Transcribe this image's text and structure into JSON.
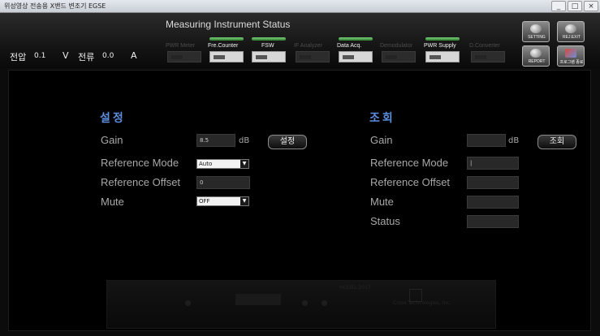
{
  "window": {
    "title": "위성영상 전송용 X밴드 변조기 EGSE",
    "controls": [
      "_",
      "□",
      "×"
    ]
  },
  "header": {
    "title": "Measuring Instrument Status",
    "voltage_label": "전압",
    "voltage_value": "0.1",
    "voltage_unit": "V",
    "current_label": "전류",
    "current_value": "0.0",
    "current_unit": "A"
  },
  "instruments": [
    {
      "label": "PWR Meter",
      "active": false
    },
    {
      "label": "Fre.Counter",
      "active": true
    },
    {
      "label": "FSW",
      "active": true
    },
    {
      "label": "IF Analyzer",
      "active": false
    },
    {
      "label": "Data Acq.",
      "active": true
    },
    {
      "label": "Demodulator",
      "active": false
    },
    {
      "label": "PWR Supply",
      "active": true
    },
    {
      "label": "D.Converter",
      "active": false
    }
  ],
  "toolbar": {
    "setting_label": "SETTING",
    "exit_label": "REJ.EXIT",
    "report_label": "REPORT",
    "extra_label": "프로그램 종료"
  },
  "setting": {
    "title": "설정",
    "gain_label": "Gain",
    "gain_value": "8.5",
    "gain_unit": "dB",
    "set_button": "설정",
    "ref_mode_label": "Reference Mode",
    "ref_mode_value": "Auto",
    "ref_offset_label": "Reference Offset",
    "ref_offset_value": "0",
    "mute_label": "Mute",
    "mute_value": "OFF"
  },
  "query": {
    "title": "조회",
    "gain_label": "Gain",
    "gain_value": "",
    "gain_unit": "dB",
    "query_button": "조회",
    "ref_mode_label": "Reference Mode",
    "ref_mode_value": "|",
    "ref_offset_label": "Reference Offset",
    "ref_offset_value": "",
    "mute_label": "Mute",
    "mute_value": "",
    "status_label": "Status",
    "status_value": ""
  },
  "device": {
    "model": "MODEL 2017",
    "brand": "Cross Technologies, Inc."
  }
}
